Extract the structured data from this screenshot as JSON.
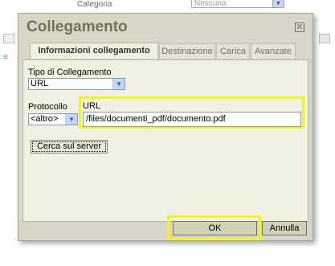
{
  "background": {
    "field_label": "Categoria",
    "select_value": "Nessuna"
  },
  "dialog": {
    "title": "Collegamento",
    "close_glyph": "✕"
  },
  "tabs": [
    {
      "label": "Informazioni collegamento",
      "active": true
    },
    {
      "label": "Destinazione",
      "active": false
    },
    {
      "label": "Carica",
      "active": false
    },
    {
      "label": "Avanzate",
      "active": false
    }
  ],
  "form": {
    "link_type_label": "Tipo di Collegamento",
    "link_type_value": "URL",
    "protocol_label": "Protocollo",
    "protocol_value": "<altro>",
    "url_label": "URL",
    "url_value": "/files/documenti_pdf/documento.pdf",
    "browse_button": "Cerca sul server"
  },
  "footer": {
    "ok_button": "OK",
    "cancel_button": "Annulla"
  },
  "colors": {
    "highlight": "#f4f416",
    "dialog_bg": "#d7d6c8",
    "panel_bg": "#f1f1e3",
    "title_color": "#737357"
  }
}
